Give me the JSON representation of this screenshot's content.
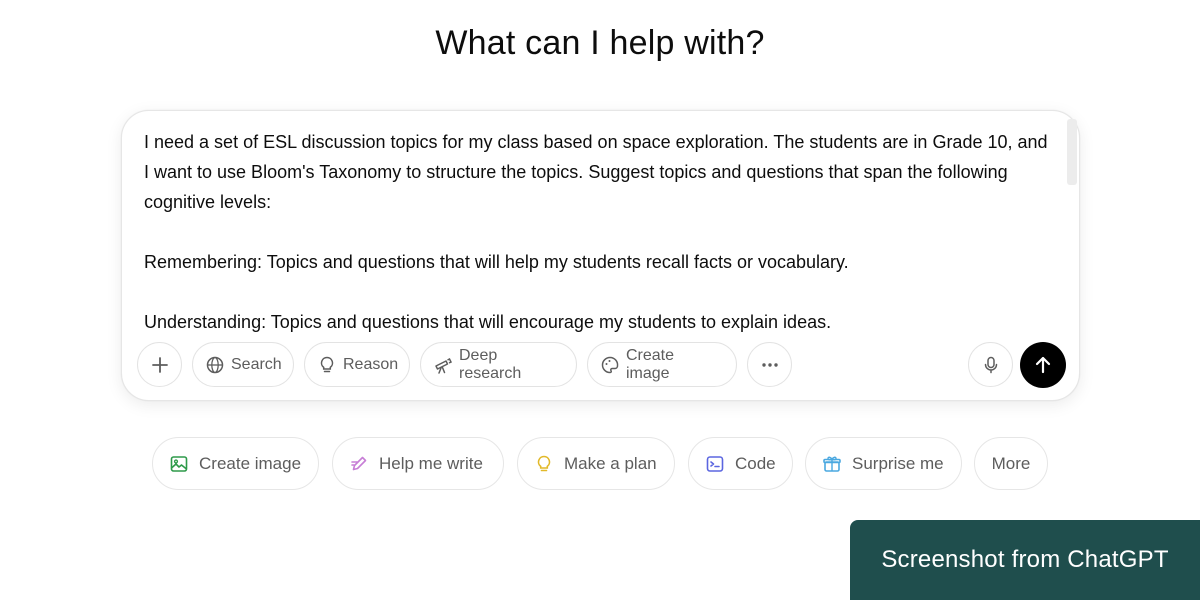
{
  "heading": "What can I help with?",
  "composer": {
    "prompt_text": "I need a set of ESL discussion topics for my class based on space exploration. The students are in Grade 10, and I want to use Bloom's Taxonomy to structure the topics. Suggest topics and questions that span the following cognitive levels:\n\nRemembering: Topics and questions that will help my students recall facts or vocabulary.\n\nUnderstanding: Topics and questions that will encourage my students to explain ideas.",
    "tools": {
      "add_icon": "plus-icon",
      "search_label": "Search",
      "reason_label": "Reason",
      "deep_research_label": "Deep research",
      "create_image_label": "Create image",
      "more_icon": "ellipsis-icon",
      "mic_icon": "microphone-icon",
      "send_icon": "arrow-up-icon"
    }
  },
  "suggestions": [
    {
      "label": "Create image",
      "icon": "image-icon",
      "color": "#2e9a4a"
    },
    {
      "label": "Help me write",
      "icon": "pen-icon",
      "color": "#c77ed6"
    },
    {
      "label": "Make a plan",
      "icon": "lightbulb-icon",
      "color": "#e2b92a"
    },
    {
      "label": "Code",
      "icon": "terminal-icon",
      "color": "#5b66e0"
    },
    {
      "label": "Surprise me",
      "icon": "gift-icon",
      "color": "#4aa8e0"
    },
    {
      "label": "More",
      "icon": "",
      "color": "#5d5d5d"
    }
  ],
  "watermark": "Screenshot from ChatGPT"
}
